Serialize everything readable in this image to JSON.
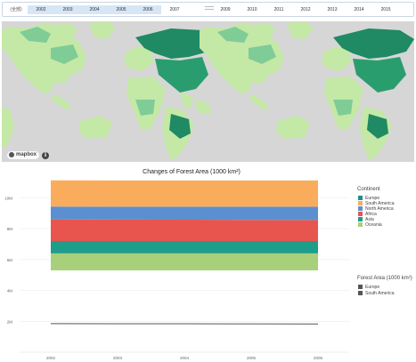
{
  "year_selector": {
    "all_label": "(全部)",
    "years": [
      {
        "label": "2002",
        "selected": true
      },
      {
        "label": "2003",
        "selected": true
      },
      {
        "label": "2004",
        "selected": true
      },
      {
        "label": "2005",
        "selected": true
      },
      {
        "label": "2006",
        "selected": true
      },
      {
        "label": "2007",
        "selected": false
      },
      {
        "label": "2009",
        "selected": false
      },
      {
        "label": "2010",
        "selected": false
      },
      {
        "label": "2011",
        "selected": false
      },
      {
        "label": "2012",
        "selected": false
      },
      {
        "label": "2013",
        "selected": false
      },
      {
        "label": "2014",
        "selected": false
      },
      {
        "label": "2015",
        "selected": false
      }
    ]
  },
  "map": {
    "attribution": "mapbox",
    "info_icon": "info-icon",
    "colors": {
      "ocean": "#d6d6d6",
      "light": "#c4e8a6",
      "mid": "#7fcc97",
      "dark": "#2a9d6e",
      "darkest": "#1f8a63"
    }
  },
  "chart_data": {
    "type": "area",
    "title": "Changes of Forest Area (1000 km²)",
    "x": [
      "2002",
      "2003",
      "2004",
      "2005",
      "2006"
    ],
    "y_ticks": [
      "2M",
      "4M",
      "6M",
      "8M",
      "10M"
    ],
    "ylim": [
      0,
      11000000
    ],
    "grid": true,
    "stack_order": [
      "Oceania",
      "Asia",
      "Africa",
      "North America",
      "South America",
      "Europe"
    ],
    "series": [
      {
        "name": "Europe",
        "color": "#1f8f8b",
        "values": [
          0,
          0,
          0,
          0,
          0
        ]
      },
      {
        "name": "South America",
        "color": "#f9ad5c",
        "values": [
          1700000,
          1700000,
          1700000,
          1700000,
          1700000
        ]
      },
      {
        "name": "North America",
        "color": "#5b8fd0",
        "values": [
          830000,
          830000,
          840000,
          850000,
          860000
        ]
      },
      {
        "name": "Africa",
        "color": "#e8554e",
        "values": [
          1400000,
          1390000,
          1380000,
          1370000,
          1360000
        ]
      },
      {
        "name": "Asia",
        "color": "#1f9d8b",
        "values": [
          800000,
          800000,
          800000,
          800000,
          800000
        ]
      },
      {
        "name": "Oceania",
        "color": "#a8d07a",
        "values": [
          1100000,
          1100000,
          1100000,
          1100000,
          1100000
        ]
      }
    ],
    "line_series": [
      {
        "name": "South America",
        "color": "#555555",
        "values": [
          1850000,
          1845000,
          1840000,
          1835000,
          1830000
        ]
      }
    ],
    "legend": {
      "color_title": "Continent",
      "color_entries": [
        {
          "label": "Europe",
          "color": "#1f8f8b"
        },
        {
          "label": "South America",
          "color": "#f9ad5c"
        },
        {
          "label": "North America",
          "color": "#5b8fd0"
        },
        {
          "label": "Africa",
          "color": "#e8554e"
        },
        {
          "label": "Asia",
          "color": "#1f9d8b"
        },
        {
          "label": "Oceania",
          "color": "#a8d07a"
        }
      ],
      "size_title": "Forest Area (1000 km²)",
      "size_entries": [
        {
          "label": "Europe",
          "color": "#555555"
        },
        {
          "label": "South America",
          "color": "#555555"
        }
      ]
    }
  }
}
